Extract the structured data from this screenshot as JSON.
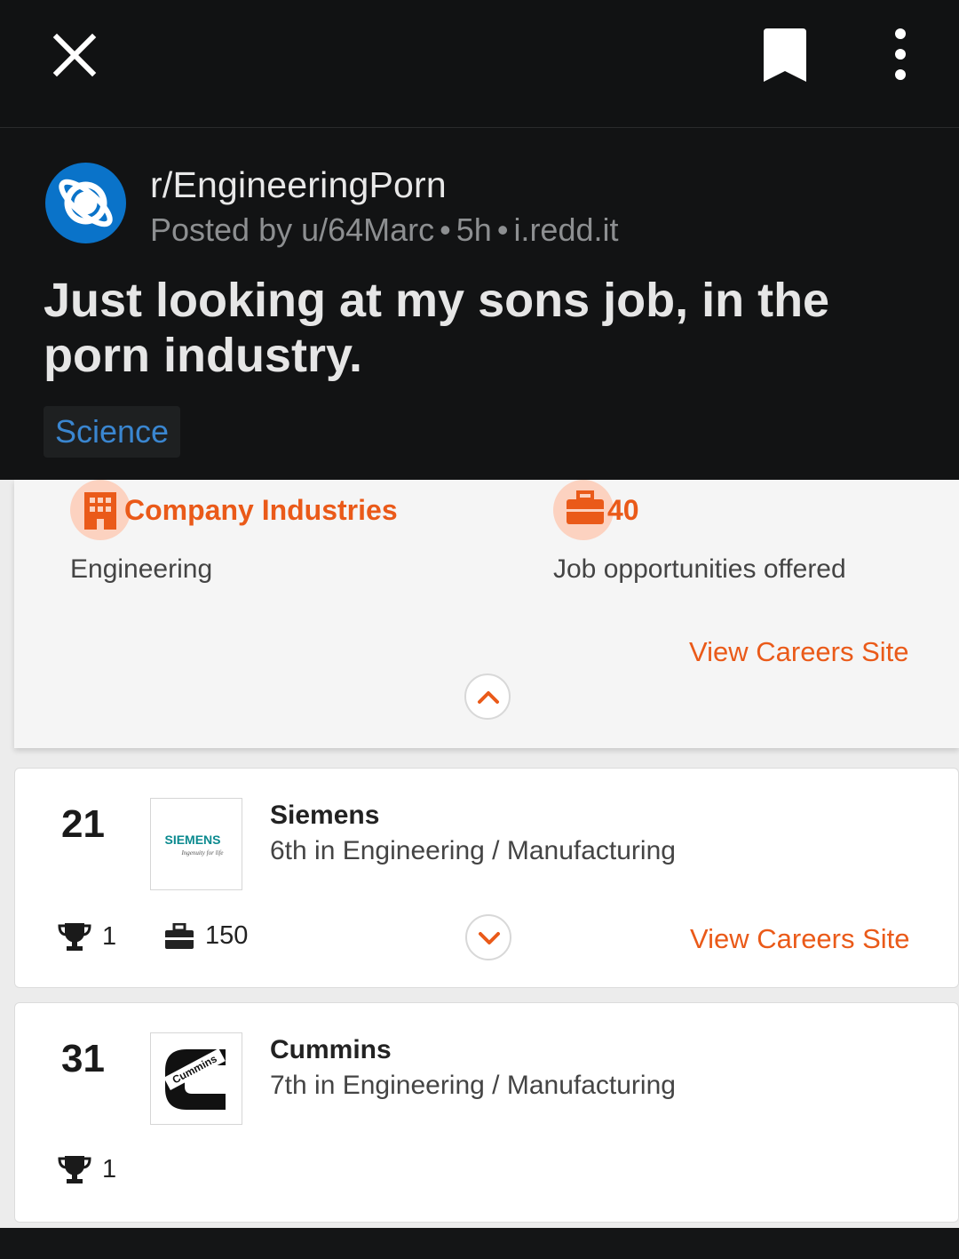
{
  "topbar": {
    "close_icon": "close-icon",
    "bookmark_icon": "bookmark-icon",
    "more_icon": "more-vertical-icon"
  },
  "post": {
    "subreddit": "r/EngineeringPorn",
    "posted_by": "Posted by u/64Marc",
    "time": "5h",
    "domain": "i.redd.it",
    "title": "Just looking at my sons job, in the porn industry.",
    "flair": "Science",
    "colors": {
      "avatar": "#0a73c9",
      "flair_text": "#3a86d0"
    }
  },
  "expanded": {
    "industries_title": "Company Industries",
    "industries_value": "Engineering",
    "jobs_count": "40",
    "jobs_label": "Job opportunities offered",
    "careers_link": "View Careers Site",
    "accent": "#ea5a19"
  },
  "companies": [
    {
      "rank": "21",
      "name": "Siemens",
      "category": "6th in Engineering / Manufacturing",
      "logo_text": "SIEMENS",
      "logo_tagline": "Ingenuity for life",
      "awards": "1",
      "jobs": "150",
      "careers_link": "View Careers Site"
    },
    {
      "rank": "31",
      "name": "Cummins",
      "category": "7th in Engineering / Manufacturing",
      "logo_text": "Cummins",
      "awards": "1"
    }
  ]
}
